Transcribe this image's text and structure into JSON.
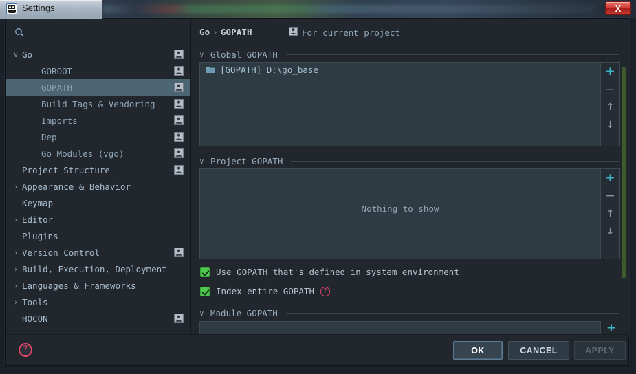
{
  "window": {
    "title": "Settings",
    "app_icon": "go-gopher-icon",
    "close_label": "X"
  },
  "search": {
    "value": "",
    "placeholder": "",
    "icon": "search-icon"
  },
  "sidebar": {
    "items": [
      {
        "label": "Go",
        "level": 0,
        "arrow": "∨",
        "badge": true,
        "selected": false
      },
      {
        "label": "GOROOT",
        "level": 1,
        "arrow": "",
        "badge": true,
        "selected": false
      },
      {
        "label": "GOPATH",
        "level": 1,
        "arrow": "",
        "badge": true,
        "selected": true
      },
      {
        "label": "Build Tags & Vendoring",
        "level": 1,
        "arrow": "",
        "badge": true,
        "selected": false
      },
      {
        "label": "Imports",
        "level": 1,
        "arrow": "",
        "badge": true,
        "selected": false
      },
      {
        "label": "Dep",
        "level": 1,
        "arrow": "",
        "badge": true,
        "selected": false
      },
      {
        "label": "Go Modules (vgo)",
        "level": 1,
        "arrow": "",
        "badge": true,
        "selected": false
      },
      {
        "label": "Project Structure",
        "level": 0,
        "arrow": "",
        "badge": true,
        "selected": false
      },
      {
        "label": "Appearance & Behavior",
        "level": 0,
        "arrow": "›",
        "badge": false,
        "selected": false
      },
      {
        "label": "Keymap",
        "level": 0,
        "arrow": "",
        "badge": false,
        "selected": false
      },
      {
        "label": "Editor",
        "level": 0,
        "arrow": "›",
        "badge": false,
        "selected": false
      },
      {
        "label": "Plugins",
        "level": 0,
        "arrow": "",
        "badge": false,
        "selected": false
      },
      {
        "label": "Version Control",
        "level": 0,
        "arrow": "›",
        "badge": true,
        "selected": false
      },
      {
        "label": "Build, Execution, Deployment",
        "level": 0,
        "arrow": "›",
        "badge": false,
        "selected": false
      },
      {
        "label": "Languages & Frameworks",
        "level": 0,
        "arrow": "›",
        "badge": false,
        "selected": false
      },
      {
        "label": "Tools",
        "level": 0,
        "arrow": "›",
        "badge": false,
        "selected": false
      },
      {
        "label": "HOCON",
        "level": 0,
        "arrow": "",
        "badge": true,
        "selected": false
      }
    ]
  },
  "breadcrumb": {
    "root": "Go",
    "separator": "›",
    "leaf": "GOPATH"
  },
  "scope": {
    "icon": "person-icon",
    "label": "For current project"
  },
  "global_gopath": {
    "section_title": "Global GOPATH",
    "chevron": "∨",
    "entries": [
      {
        "icon": "folder-icon",
        "label": "[GOPATH] D:\\go_base"
      }
    ],
    "tools": {
      "add": "+",
      "remove": "−",
      "move_up": "↑",
      "move_down": "↓"
    }
  },
  "project_gopath": {
    "section_title": "Project GOPATH",
    "chevron": "∨",
    "empty_text": "Nothing to show",
    "tools": {
      "add": "+",
      "remove": "−",
      "move_up": "↑",
      "move_down": "↓"
    }
  },
  "options": [
    {
      "label": "Use GOPATH that's defined in system environment",
      "checked": true,
      "help": false
    },
    {
      "label": "Index entire GOPATH",
      "checked": true,
      "help": true,
      "help_glyph": "?"
    }
  ],
  "module_gopath": {
    "section_title": "Module GOPATH",
    "chevron": "∨",
    "value": "",
    "add": "+"
  },
  "footer": {
    "help_glyph": "?",
    "ok_label": "OK",
    "cancel_label": "CANCEL",
    "apply_label": "APPLY"
  },
  "colors": {
    "dialog_bg": "#22272e",
    "panel_bg": "#2f3b43",
    "selection": "#4b6572",
    "accent_plus": "#3cb6c9",
    "checkbox_green": "#4fc74f",
    "help_red": "#e0456a",
    "scrollbar_green": "#3e5b2c",
    "text_primary": "#c6cfd8",
    "text_muted": "#8fa6b8"
  }
}
